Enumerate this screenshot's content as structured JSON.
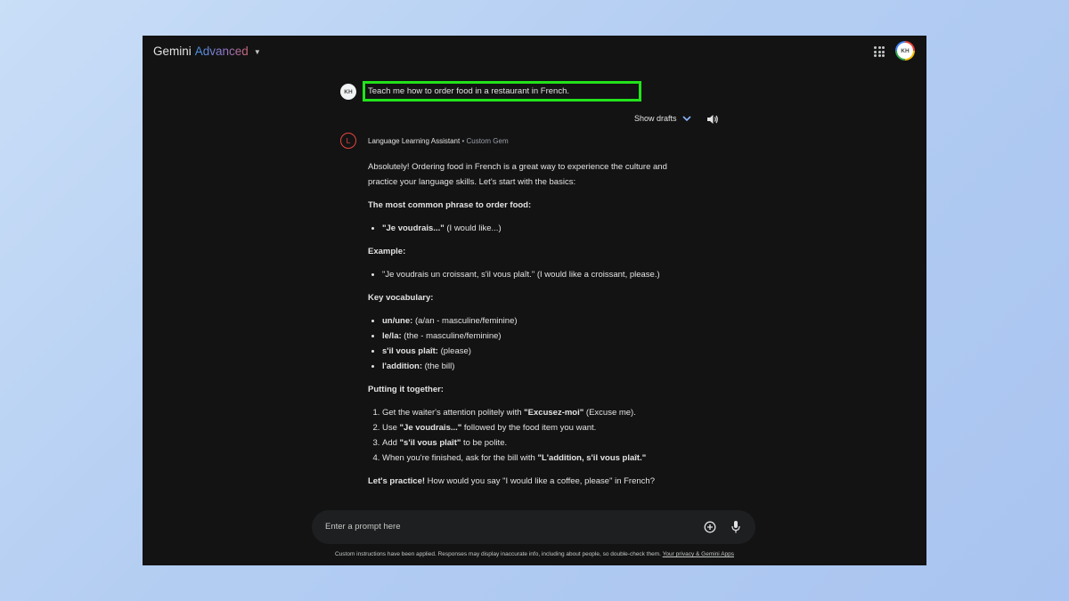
{
  "topbar": {
    "brand_name": "Gemini",
    "brand_tier": "Advanced",
    "account_initials": "KH",
    "apps_icon": "apps-grid-icon"
  },
  "user_message": {
    "avatar_initials": "KH",
    "text": "Teach me how to order food in a restaurant in French.",
    "highlight_color": "#22e31b"
  },
  "drafts": {
    "label": "Show drafts"
  },
  "gem": {
    "avatar_letter": "L",
    "name": "Language Learning Assistant",
    "separator": "•",
    "type": "Custom Gem"
  },
  "response": {
    "intro": "Absolutely! Ordering food in French is a great way to experience the culture and practice your language skills. Let's start with the basics:",
    "phrase_heading": "The most common phrase to order food:",
    "phrase_bold": "\"Je voudrais...\"",
    "phrase_rest": " (I would like...)",
    "example_heading": "Example:",
    "example_item": "\"Je voudrais un croissant, s'il vous plaît.\" (I would like a croissant, please.)",
    "vocab_heading": "Key vocabulary:",
    "vocab": [
      {
        "term": "un/une:",
        "meaning": " (a/an - masculine/feminine)"
      },
      {
        "term": "le/la:",
        "meaning": " (the - masculine/feminine)"
      },
      {
        "term": "s'il vous plaît:",
        "meaning": " (please)"
      },
      {
        "term": "l'addition:",
        "meaning": " (the bill)"
      }
    ],
    "together_heading": "Putting it together:",
    "steps": [
      {
        "pre": "Get the waiter's attention politely with ",
        "bold": "\"Excusez-moi\"",
        "post": " (Excuse me)."
      },
      {
        "pre": "Use ",
        "bold": "\"Je voudrais...\"",
        "post": " followed by the food item you want."
      },
      {
        "pre": "Add ",
        "bold": "\"s'il vous plaît\"",
        "post": " to be polite."
      },
      {
        "pre": "When you're finished, ask for the bill with ",
        "bold": "\"L'addition, s'il vous plaît.\"",
        "post": ""
      }
    ],
    "practice_bold": "Let's practice!",
    "practice_rest": " How would you say \"I would like a coffee, please\" in French?"
  },
  "input": {
    "placeholder": "Enter a prompt here"
  },
  "footer": {
    "disclaimer": "Custom instructions have been applied. Responses may display inaccurate info, including about people, so double-check them. ",
    "link": "Your privacy & Gemini Apps"
  }
}
